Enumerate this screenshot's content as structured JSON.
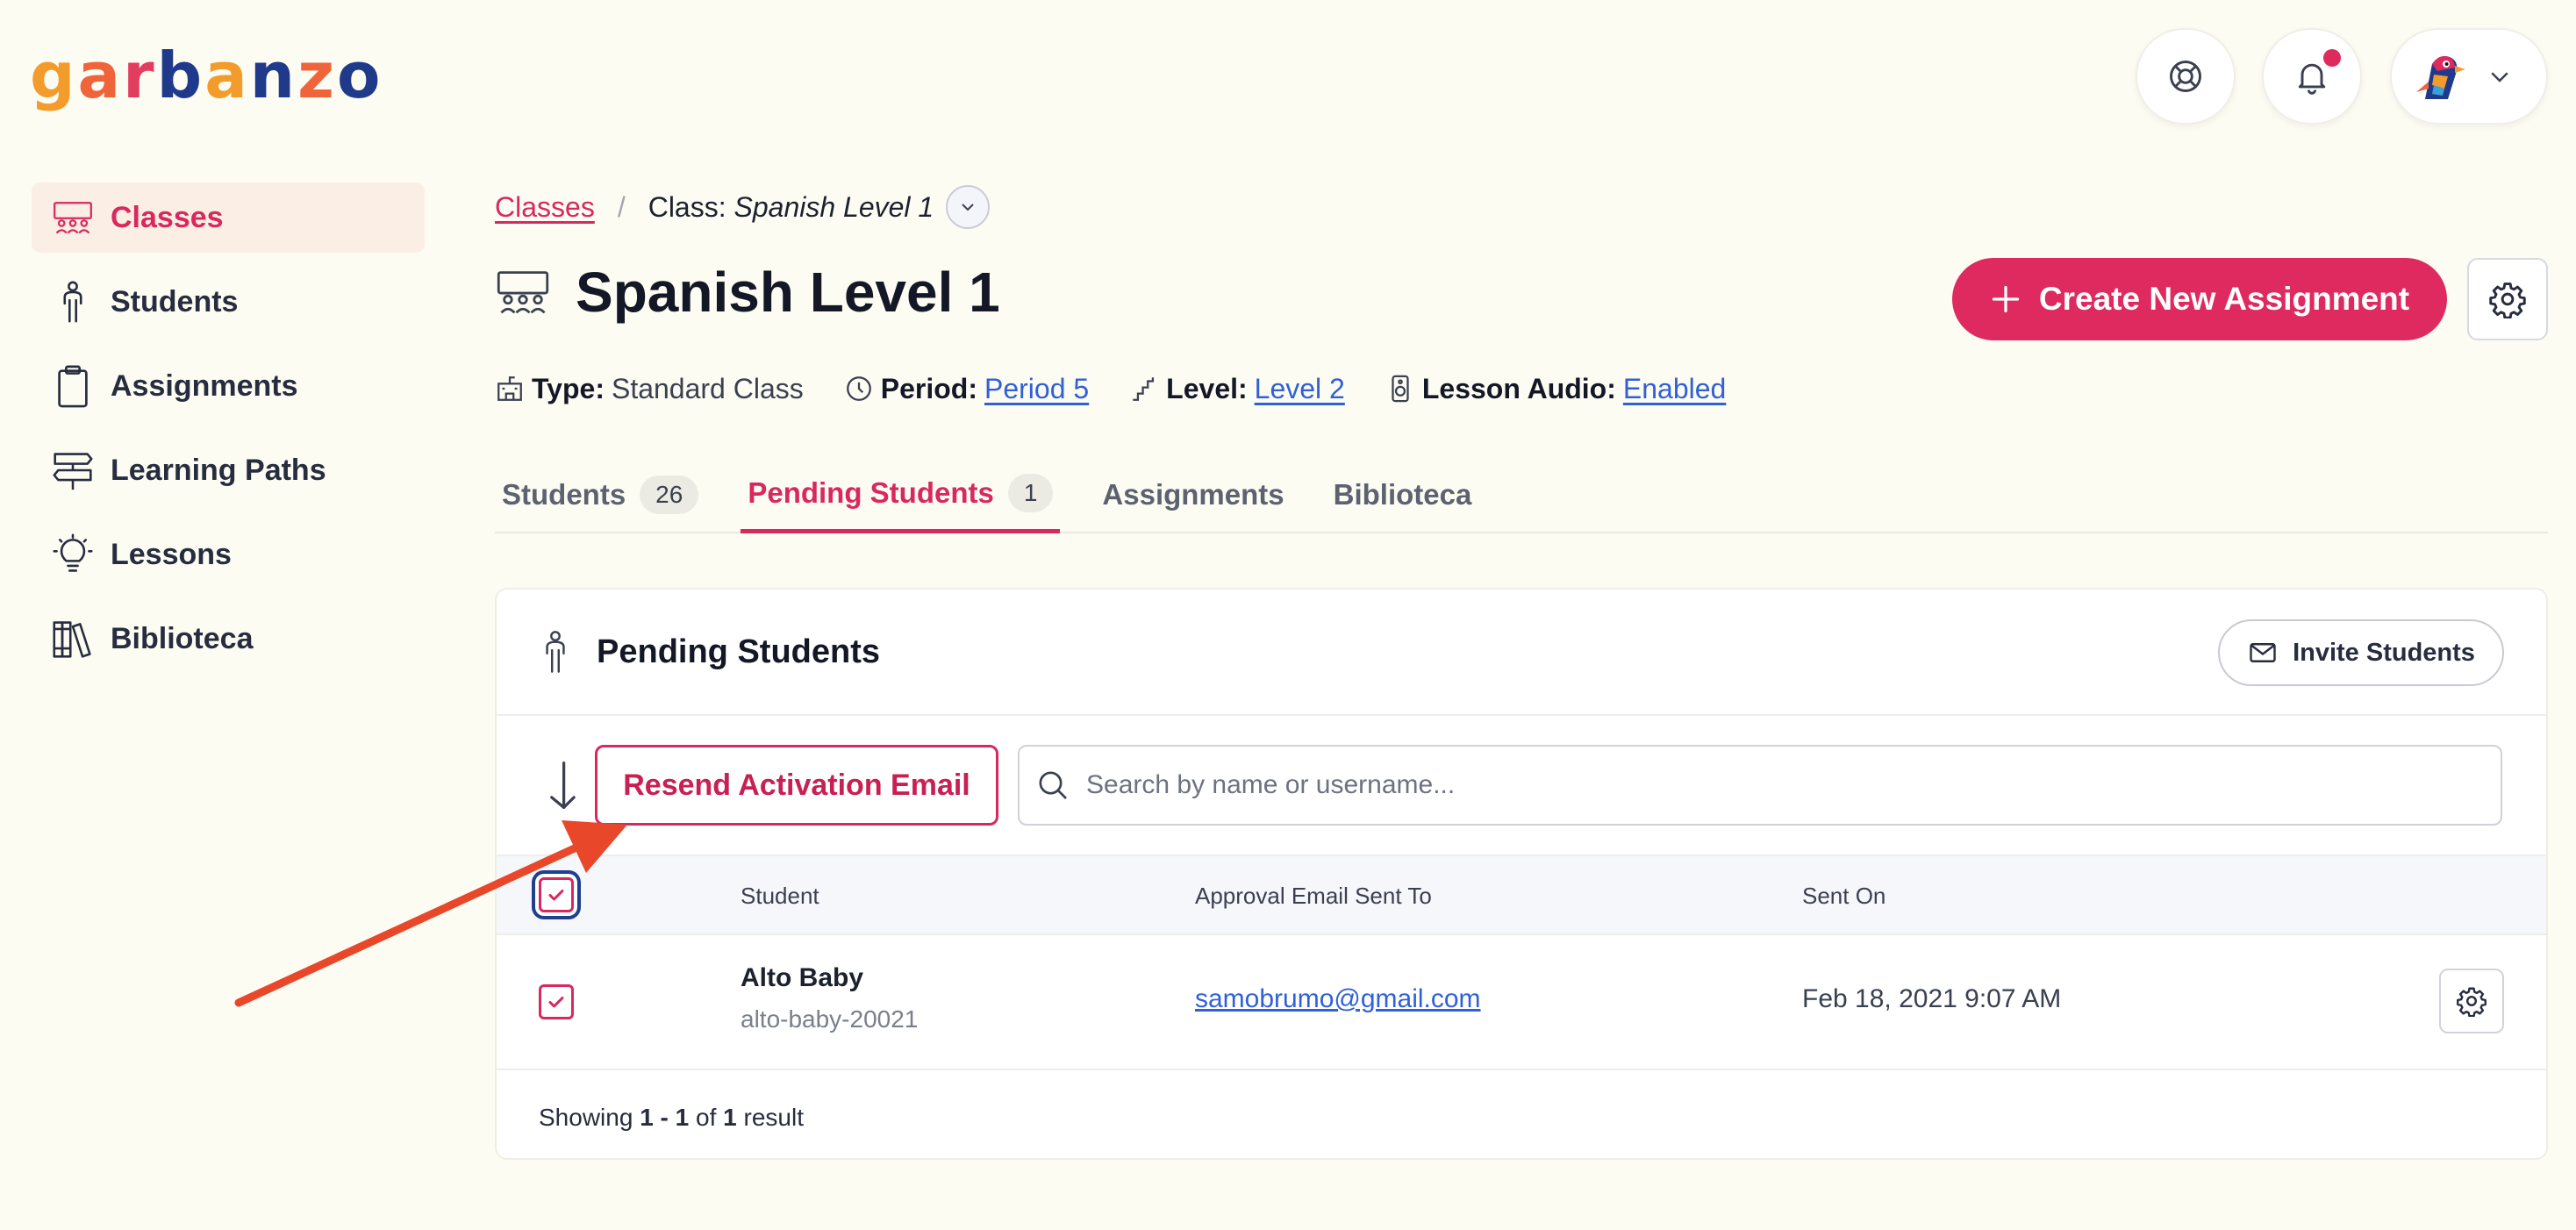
{
  "logo": {
    "letters": [
      "g",
      "a",
      "r",
      "b",
      "a",
      "n",
      "z",
      "o"
    ],
    "colors": [
      "#f39c2c",
      "#f0643c",
      "#e23c5e",
      "#1f3a8a",
      "#f39c2c",
      "#1f3a8a",
      "#f0643c",
      "#1f3a8a"
    ]
  },
  "header": {
    "help_icon": "lifebuoy-icon",
    "bell_icon": "bell-icon",
    "avatar_icon": "parrot-avatar",
    "dropdown_icon": "chevron-down-icon"
  },
  "sidebar": {
    "items": [
      {
        "label": "Classes",
        "icon": "classroom-icon",
        "active": true
      },
      {
        "label": "Students",
        "icon": "student-icon",
        "active": false
      },
      {
        "label": "Assignments",
        "icon": "clipboard-icon",
        "active": false
      },
      {
        "label": "Learning Paths",
        "icon": "signpost-icon",
        "active": false
      },
      {
        "label": "Lessons",
        "icon": "lightbulb-icon",
        "active": false
      },
      {
        "label": "Biblioteca",
        "icon": "books-icon",
        "active": false
      }
    ]
  },
  "breadcrumb": {
    "root": "Classes",
    "separator": "/",
    "current_prefix": "Class:",
    "current_name": "Spanish Level 1"
  },
  "page": {
    "title": "Spanish Level 1",
    "create_label": "Create New Assignment"
  },
  "meta": {
    "type_label": "Type:",
    "type_value": "Standard Class",
    "period_label": "Period:",
    "period_value": "Period 5",
    "level_label": "Level:",
    "level_value": "Level 2",
    "audio_label": "Lesson Audio:",
    "audio_value": "Enabled"
  },
  "tabs": [
    {
      "label": "Students",
      "count": "26",
      "active": false
    },
    {
      "label": "Pending Students",
      "count": "1",
      "active": true
    },
    {
      "label": "Assignments",
      "active": false
    },
    {
      "label": "Biblioteca",
      "active": false
    }
  ],
  "card": {
    "title": "Pending Students",
    "invite_label": "Invite Students",
    "resend_label": "Resend Activation Email",
    "search_placeholder": "Search by name or username...",
    "columns": {
      "student": "Student",
      "email": "Approval Email Sent To",
      "sent_on": "Sent On"
    },
    "rows": [
      {
        "name": "Alto Baby",
        "username": "alto-baby-20021",
        "email": "samobrumo@gmail.com",
        "sent_on": "Feb 18, 2021 9:07 AM",
        "checked": true
      }
    ],
    "footer_prefix": "Showing",
    "footer_range": "1 - 1",
    "footer_of": "of",
    "footer_total": "1",
    "footer_suffix": "result"
  },
  "colors": {
    "accent": "#de2a5e",
    "link": "#3060d8",
    "background": "#fdfcf3",
    "annotation_arrow": "#e8472a"
  }
}
